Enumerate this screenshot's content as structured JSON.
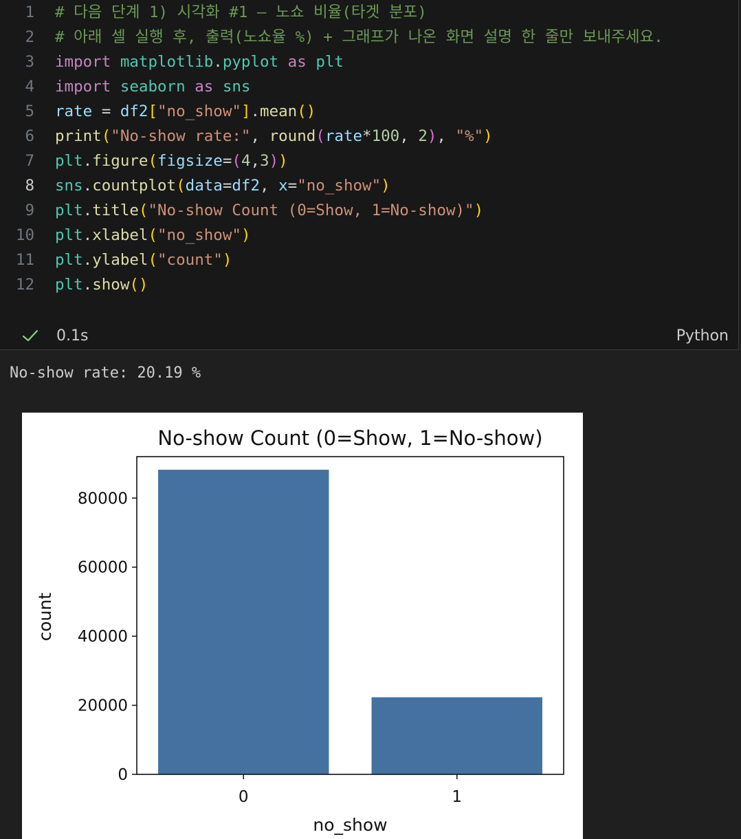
{
  "code_cell": {
    "lines": [
      {
        "num": "1",
        "tokens": [
          {
            "t": "# 다음 단계 1) 시각화 #1 — 노쇼 비율(타겟 분포)",
            "c": "comment"
          }
        ]
      },
      {
        "num": "2",
        "tokens": [
          {
            "t": "# 아래 셀 실행 후, 출력(노쇼율 %) + 그래프가 나온 화면 설명 한 줄만 보내주세요.",
            "c": "comment"
          }
        ]
      },
      {
        "num": "3",
        "tokens": [
          {
            "t": "import",
            "c": "kw"
          },
          {
            "t": " ",
            "c": "op"
          },
          {
            "t": "matplotlib",
            "c": "mod"
          },
          {
            "t": ".",
            "c": "op"
          },
          {
            "t": "pyplot",
            "c": "mod"
          },
          {
            "t": " ",
            "c": "op"
          },
          {
            "t": "as",
            "c": "kw"
          },
          {
            "t": " ",
            "c": "op"
          },
          {
            "t": "plt",
            "c": "mod"
          }
        ]
      },
      {
        "num": "4",
        "tokens": [
          {
            "t": "import",
            "c": "kw"
          },
          {
            "t": " ",
            "c": "op"
          },
          {
            "t": "seaborn",
            "c": "mod"
          },
          {
            "t": " ",
            "c": "op"
          },
          {
            "t": "as",
            "c": "kw"
          },
          {
            "t": " ",
            "c": "op"
          },
          {
            "t": "sns",
            "c": "mod"
          }
        ]
      },
      {
        "num": "5",
        "tokens": [
          {
            "t": "rate",
            "c": "var"
          },
          {
            "t": " = ",
            "c": "op"
          },
          {
            "t": "df2",
            "c": "var"
          },
          {
            "t": "[",
            "c": "b1"
          },
          {
            "t": "\"no_show\"",
            "c": "str"
          },
          {
            "t": "]",
            "c": "b1"
          },
          {
            "t": ".",
            "c": "op"
          },
          {
            "t": "mean",
            "c": "fn"
          },
          {
            "t": "()",
            "c": "b1"
          }
        ]
      },
      {
        "num": "6",
        "tokens": [
          {
            "t": "print",
            "c": "fn"
          },
          {
            "t": "(",
            "c": "b1"
          },
          {
            "t": "\"No-show rate:\"",
            "c": "str"
          },
          {
            "t": ", ",
            "c": "op"
          },
          {
            "t": "round",
            "c": "fn"
          },
          {
            "t": "(",
            "c": "b2"
          },
          {
            "t": "rate",
            "c": "var"
          },
          {
            "t": "*",
            "c": "op"
          },
          {
            "t": "100",
            "c": "num"
          },
          {
            "t": ", ",
            "c": "op"
          },
          {
            "t": "2",
            "c": "num"
          },
          {
            "t": ")",
            "c": "b2"
          },
          {
            "t": ", ",
            "c": "op"
          },
          {
            "t": "\"%\"",
            "c": "str"
          },
          {
            "t": ")",
            "c": "b1"
          }
        ]
      },
      {
        "num": "7",
        "tokens": [
          {
            "t": "plt",
            "c": "mod"
          },
          {
            "t": ".",
            "c": "op"
          },
          {
            "t": "figure",
            "c": "fn"
          },
          {
            "t": "(",
            "c": "b1"
          },
          {
            "t": "figsize",
            "c": "var"
          },
          {
            "t": "=",
            "c": "op"
          },
          {
            "t": "(",
            "c": "b2"
          },
          {
            "t": "4",
            "c": "num"
          },
          {
            "t": ",",
            "c": "op"
          },
          {
            "t": "3",
            "c": "num"
          },
          {
            "t": ")",
            "c": "b2"
          },
          {
            "t": ")",
            "c": "b1"
          }
        ]
      },
      {
        "num": "8",
        "active": true,
        "tokens": [
          {
            "t": "sns",
            "c": "mod"
          },
          {
            "t": ".",
            "c": "op"
          },
          {
            "t": "countplot",
            "c": "fn"
          },
          {
            "t": "(",
            "c": "b1"
          },
          {
            "t": "data",
            "c": "var"
          },
          {
            "t": "=",
            "c": "op"
          },
          {
            "t": "df2",
            "c": "var"
          },
          {
            "t": ", ",
            "c": "op"
          },
          {
            "t": "x",
            "c": "var"
          },
          {
            "t": "=",
            "c": "op"
          },
          {
            "t": "\"no_show\"",
            "c": "str"
          },
          {
            "t": ")",
            "c": "b1"
          }
        ]
      },
      {
        "num": "9",
        "tokens": [
          {
            "t": "plt",
            "c": "mod"
          },
          {
            "t": ".",
            "c": "op"
          },
          {
            "t": "title",
            "c": "fn"
          },
          {
            "t": "(",
            "c": "b1"
          },
          {
            "t": "\"No-show Count (0=Show, 1=No-show)\"",
            "c": "str"
          },
          {
            "t": ")",
            "c": "b1"
          }
        ]
      },
      {
        "num": "10",
        "tokens": [
          {
            "t": "plt",
            "c": "mod"
          },
          {
            "t": ".",
            "c": "op"
          },
          {
            "t": "xlabel",
            "c": "fn"
          },
          {
            "t": "(",
            "c": "b1"
          },
          {
            "t": "\"no_show\"",
            "c": "str"
          },
          {
            "t": ")",
            "c": "b1"
          }
        ]
      },
      {
        "num": "11",
        "tokens": [
          {
            "t": "plt",
            "c": "mod"
          },
          {
            "t": ".",
            "c": "op"
          },
          {
            "t": "ylabel",
            "c": "fn"
          },
          {
            "t": "(",
            "c": "b1"
          },
          {
            "t": "\"count\"",
            "c": "str"
          },
          {
            "t": ")",
            "c": "b1"
          }
        ]
      },
      {
        "num": "12",
        "tokens": [
          {
            "t": "plt",
            "c": "mod"
          },
          {
            "t": ".",
            "c": "op"
          },
          {
            "t": "show",
            "c": "fn"
          },
          {
            "t": "()",
            "c": "b1"
          }
        ]
      }
    ]
  },
  "status": {
    "check_icon": "checkmark-icon",
    "check_color": "#89d185",
    "exec_time": "0.1s",
    "language": "Python"
  },
  "output": {
    "text": "No-show rate: 20.19 %"
  },
  "chart_data": {
    "type": "bar",
    "title": "No-show Count (0=Show, 1=No-show)",
    "xlabel": "no_show",
    "ylabel": "count",
    "categories": [
      "0",
      "1"
    ],
    "values": [
      88208,
      22319
    ],
    "ylim": [
      0,
      92000
    ],
    "yticks": [
      0,
      20000,
      40000,
      60000,
      80000
    ],
    "bar_color": "#4571a0",
    "grid": false
  }
}
